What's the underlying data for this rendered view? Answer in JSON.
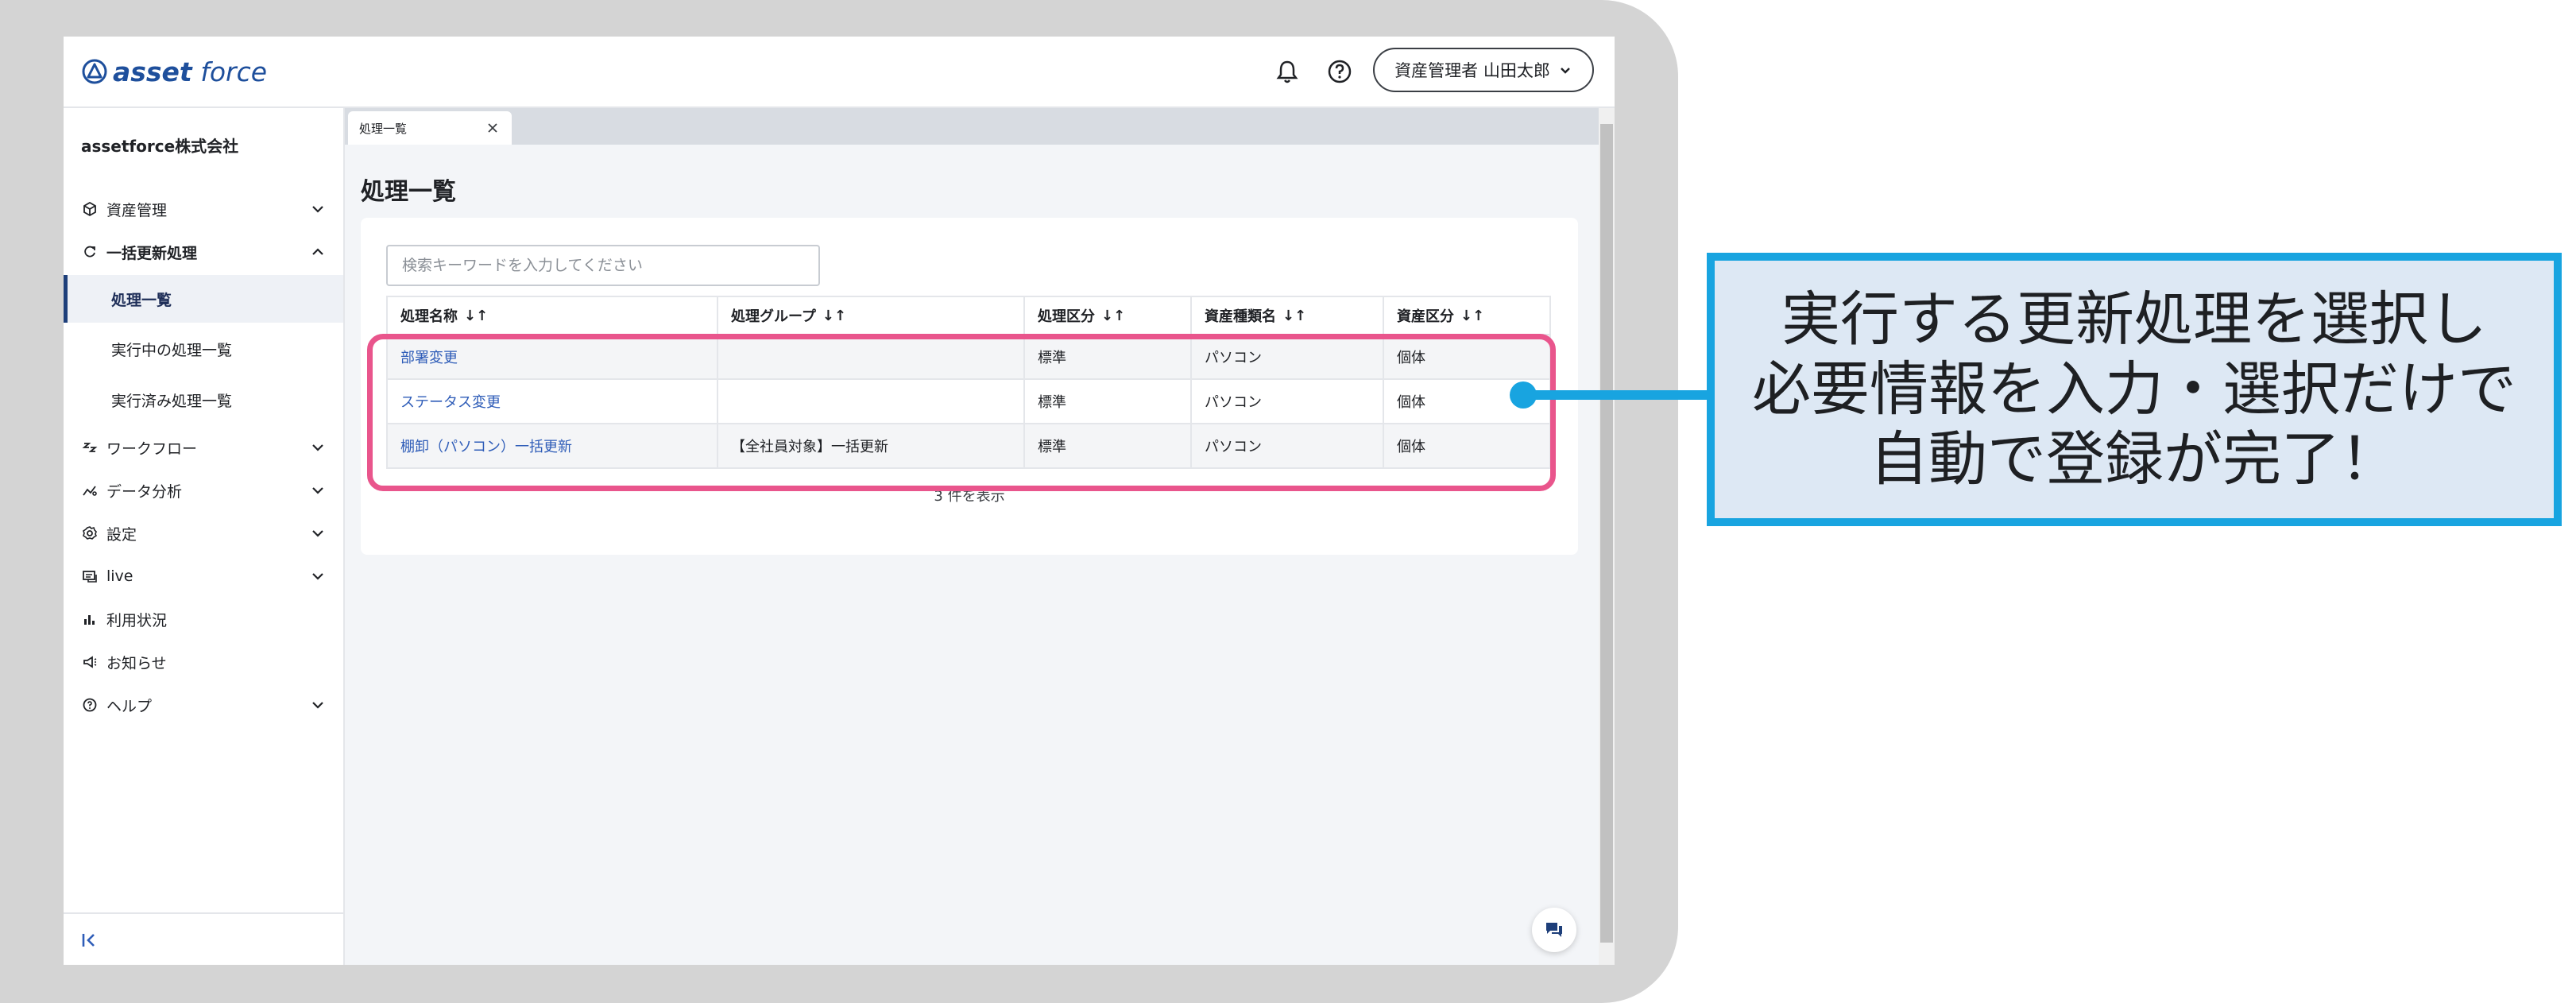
{
  "app": {
    "logo_prefix": "asset",
    "logo_suffix": "force"
  },
  "header": {
    "user_label": "資産管理者 山田太郎"
  },
  "sidebar": {
    "company": "assetforce株式会社",
    "items": [
      {
        "label": "資産管理"
      },
      {
        "label": "一括更新処理"
      },
      {
        "label": "処理一覧"
      },
      {
        "label": "実行中の処理一覧"
      },
      {
        "label": "実行済み処理一覧"
      },
      {
        "label": "ワークフロー"
      },
      {
        "label": "データ分析"
      },
      {
        "label": "設定"
      },
      {
        "label": "live"
      },
      {
        "label": "利用状況"
      },
      {
        "label": "お知らせ"
      },
      {
        "label": "ヘルプ"
      }
    ]
  },
  "tabs": [
    {
      "label": "処理一覧"
    }
  ],
  "main": {
    "title": "処理一覧",
    "search_placeholder": "検索キーワードを入力してください",
    "columns": [
      "処理名称",
      "処理グループ",
      "処理区分",
      "資産種類名",
      "資産区分"
    ],
    "sort_symbol": "↓↑",
    "rows": [
      [
        "部署変更",
        "",
        "標準",
        "パソコン",
        "個体"
      ],
      [
        "ステータス変更",
        "",
        "標準",
        "パソコン",
        "個体"
      ],
      [
        "棚卸（パソコン）一括更新",
        "【全社員対象】一括更新",
        "標準",
        "パソコン",
        "個体"
      ]
    ],
    "count_text": "3 件を表示"
  },
  "callout": {
    "lines": [
      "実行する更新処理を選択し",
      "必要情報を入力・選択だけで",
      "自動で登録が完了！"
    ]
  },
  "colors": {
    "brand": "#1e4f9c",
    "link": "#2f5db8",
    "highlight": "#e9558c",
    "callout_border": "#18a4e0",
    "callout_bg": "#dde8f4"
  }
}
